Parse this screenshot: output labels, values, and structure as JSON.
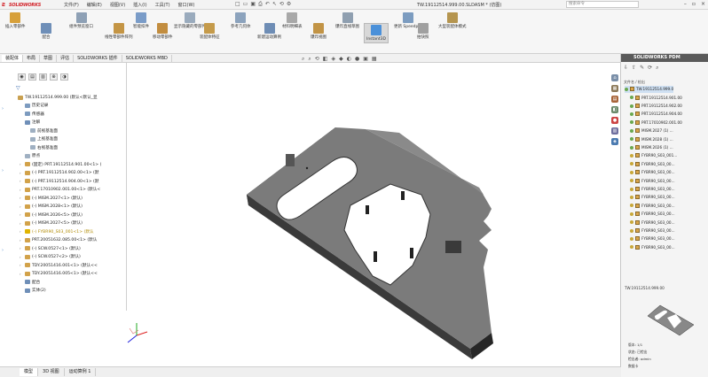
{
  "app": {
    "logo_text": "SOLIDWORKS",
    "menus": [
      "文件(F)",
      "编辑(E)",
      "视图(V)",
      "插入(I)",
      "工具(T)",
      "窗口(W)"
    ],
    "doc_title": "TW.19112514.999.00.SLDASM * (仿图)",
    "search_placeholder": "搜索命令"
  },
  "ribbon": {
    "buttons": [
      {
        "label": "插入零部件",
        "color": "#d7a03a"
      },
      {
        "label": "配合",
        "color": "#6f8fb8"
      },
      {
        "label": "组件预览窗口",
        "color": "#8ea0b5"
      },
      {
        "label": "线性零部件阵列",
        "color": "#c49545"
      },
      {
        "label": "智能扣件",
        "color": "#7a9cc8"
      },
      {
        "label": "移动零部件",
        "color": "#c28d3f"
      },
      {
        "label": "显示隐藏的零部件",
        "color": "#9aabbd"
      },
      {
        "label": "装配体特征",
        "color": "#c59b4b"
      },
      {
        "label": "参考几何体",
        "color": "#8ca3bd"
      },
      {
        "label": "新建运动算例",
        "color": "#6e8db5"
      },
      {
        "label": "材料明细表",
        "color": "#a8a8a8"
      },
      {
        "label": "爆炸视图",
        "color": "#c29446"
      },
      {
        "label": "爆炸直线草图",
        "color": "#8f9fb0"
      },
      {
        "label": "Instant3D",
        "color": "#4a90d9"
      },
      {
        "label": "更新 Speedpak",
        "color": "#7c9cc0"
      },
      {
        "label": "拍快照",
        "color": "#a0a0a0"
      },
      {
        "label": "大型装配体模式",
        "color": "#b5954f"
      }
    ]
  },
  "cmd_tabs": [
    "装配体",
    "布局",
    "草图",
    "评估",
    "SOLIDWORKS 插件",
    "SOLIDWORKS MBD"
  ],
  "tree": {
    "root": "TW.19112514.999.00 (默认<默认_显",
    "rows": [
      {
        "label": "历史记录",
        "color": "#7d9bbf"
      },
      {
        "label": "传感器",
        "color": "#7d9bbf"
      },
      {
        "label": "注解",
        "color": "#6f8fb8"
      },
      {
        "label": "前视基准面",
        "color": "#9fb0c2"
      },
      {
        "label": "上视基准面",
        "color": "#9fb0c2"
      },
      {
        "label": "右视基准面",
        "color": "#9fb0c2"
      },
      {
        "label": "原点",
        "color": "#9fb0c2"
      },
      {
        "label": "(固定) PRT.19112514.901.00<1> (",
        "color": "#d2a24a"
      },
      {
        "label": "(-) PRT.19112514.902.00<1> (默",
        "color": "#d2a24a"
      },
      {
        "label": "(-) PRT.19112514.904.00<1> (默",
        "color": "#d2a24a"
      },
      {
        "label": "PRT.17010902.001.00<1> (默认<",
        "color": "#d2a24a"
      },
      {
        "label": "(-) MISM.2027<1> (默认)",
        "color": "#d2a24a"
      },
      {
        "label": "(-) MISM.2028<1> (默认)",
        "color": "#d2a24a"
      },
      {
        "label": "(-) MISM.2026<5> (默认)",
        "color": "#d2a24a"
      },
      {
        "label": "(-) MISM.2027<5> (默认)",
        "color": "#d2a24a"
      },
      {
        "label": "(-) FYBR90_S03_001<1> (默认",
        "color": "#e0b400"
      },
      {
        "label": "PRT.20051632.085.00<1> (默认",
        "color": "#d2a24a"
      },
      {
        "label": "(-) SCW.0527<1> (默认)",
        "color": "#d2a24a"
      },
      {
        "label": "(-) SCW.0527<2> (默认)",
        "color": "#d2a24a"
      },
      {
        "label": "TDY.20051416.001<1> (默认<<",
        "color": "#d2a24a"
      },
      {
        "label": "TDY.20051416.005<1> (默认<<",
        "color": "#d2a24a"
      },
      {
        "label": "配合",
        "color": "#6f8fb8"
      },
      {
        "label": "实体(2)",
        "color": "#6f8fb8"
      }
    ]
  },
  "bottom_tabs": [
    "模型",
    "3D 视图",
    "运动算例 1"
  ],
  "pdm": {
    "title": "SOLIDWORKS PDM",
    "column_header": "文件名 / 检出",
    "rows": [
      "TW.19112514.999.0",
      "PRT.19112514.901.00",
      "PRT.19112514.902.00",
      "PRT.19112514.904.00",
      "PRT.17010902.001.00",
      "MISM.2027 (1) ...",
      "MISM.2028 (1) ...",
      "MISM.2026 (1) ...",
      "FYBR90_S03_001...",
      "FYBR90_S03_00...",
      "FYBR90_S03_00...",
      "FYBR90_S03_00...",
      "FYBR90_S03_00...",
      "FYBR90_S03_00...",
      "FYBR90_S03_00...",
      "FYBR90_S03_00...",
      "FYBR90_S03_00...",
      "FYBR90_S03_00...",
      "FYBR90_S03_00...",
      "FYBR90_S03_00..."
    ],
    "preview_label": "TW.19112514.999.00",
    "details": [
      "版本: 1/1",
      "状态: 已检出",
      "检出者: admin",
      "数据卡"
    ]
  }
}
